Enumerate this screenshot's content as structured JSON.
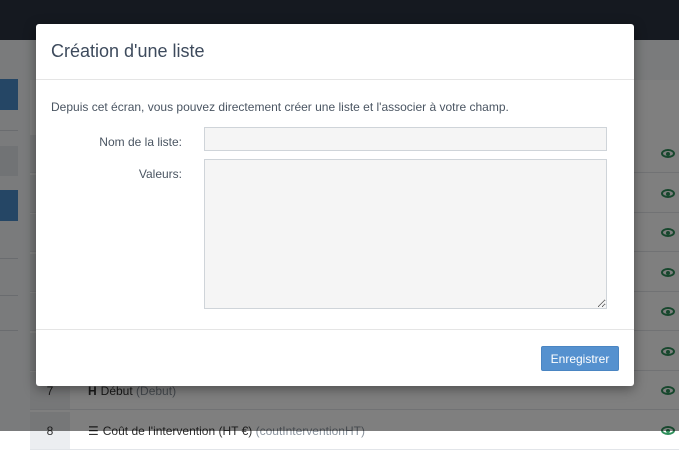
{
  "background": {
    "rows": [
      {
        "index": "",
        "glyph": "",
        "text": "",
        "sub": ""
      },
      {
        "index": "",
        "glyph": "",
        "text": "",
        "sub": ""
      },
      {
        "index": "",
        "glyph": "",
        "text": "",
        "sub": ""
      },
      {
        "index": "",
        "glyph": "",
        "text": "",
        "sub": ""
      },
      {
        "index": "",
        "glyph": "",
        "text": "",
        "sub": ""
      },
      {
        "index": "",
        "glyph": "",
        "text": "",
        "sub": ""
      },
      {
        "index": "7",
        "glyph": "H",
        "text": "Début",
        "sub": "(Debut)"
      },
      {
        "index": "8",
        "glyph": "☰",
        "text": "Coût de l'intervention (HT €)",
        "sub": "(coutInterventionHT)"
      }
    ],
    "eye_icon": "eye-icon",
    "accent_color": "#4a8cca",
    "eye_color": "#2f8f5b"
  },
  "modal": {
    "title": "Création d'une liste",
    "intro": "Depuis cet écran, vous pouvez directement créer une liste et l'associer à votre champ.",
    "fields": {
      "name_label": "Nom de la liste:",
      "name_value": "",
      "values_label": "Valeurs:",
      "values_value": ""
    },
    "save_label": "Enregistrer",
    "button_color": "#5591cf"
  }
}
